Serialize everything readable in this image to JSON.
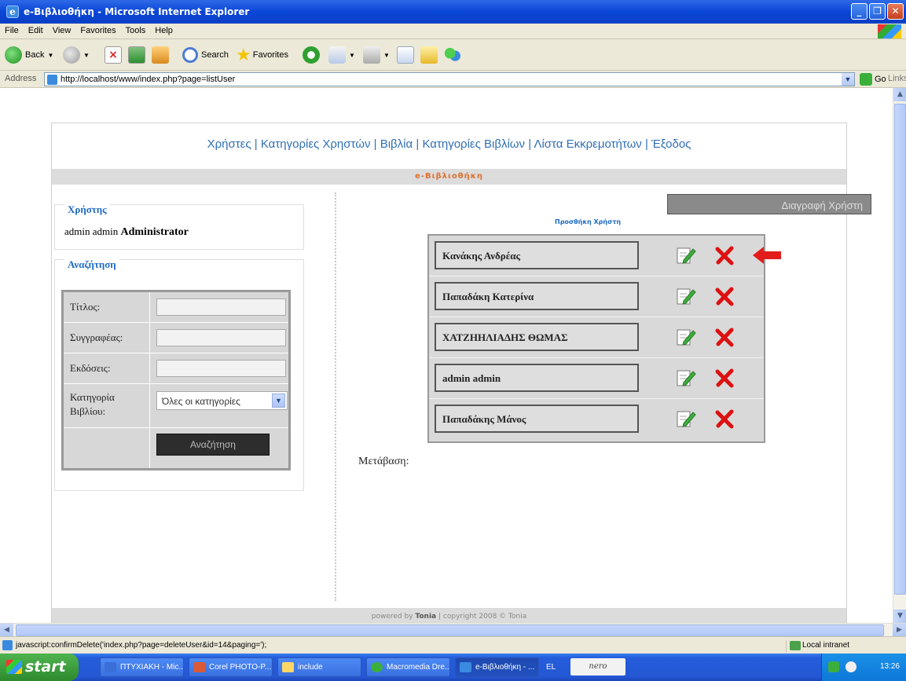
{
  "window": {
    "title": "e-Βιβλιοθήκη - Microsoft Internet Explorer",
    "ie_letter": "e"
  },
  "menu": [
    "File",
    "Edit",
    "View",
    "Favorites",
    "Tools",
    "Help"
  ],
  "toolbar": {
    "back": "Back",
    "search": "Search",
    "favorites": "Favorites"
  },
  "address": {
    "label": "Address",
    "url": "http://localhost/www/index.php?page=listUser",
    "go": "Go",
    "links": "Links"
  },
  "page": {
    "nav": [
      "Χρήστες",
      "Κατηγορίες Χρηστών",
      "Βιβλία",
      "Κατηγορίες Βιβλίων",
      "Λίστα Εκκρεμοτήτων",
      "Έξοδος"
    ],
    "nav_sep": "|",
    "brand": "e-Βιβλιοθήκη",
    "user_box": {
      "title": "Χρήστης",
      "first": "admin",
      "last": "admin",
      "role": "Administrator"
    },
    "search_box": {
      "title": "Αναζήτηση",
      "fields": [
        "Τίτλος:",
        "Συγγραφέας:",
        "Εκδόσεις:"
      ],
      "category_label": "Κατηγορία Βιβλίου:",
      "category_value": "Όλες οι κατηγορίες",
      "button": "Αναζήτηση"
    },
    "add_user_link": "Προσθήκη Χρήστη",
    "delete_banner": "Διαγραφή Χρήστη",
    "users": [
      "Κανάκης Ανδρέας",
      "Παπαδάκη Κατερίνα",
      "ΧΑΤΖΗΗΛΙΑΔΗΣ ΘΩΜΑΣ",
      "admin admin",
      "Παπαδάκης Μάνος"
    ],
    "goto_label": "Μετάβαση:",
    "footer": {
      "powered": "powered by",
      "author": "Tonia",
      "copyright": "copyright 2008 © Tonia"
    }
  },
  "status": {
    "text": "javascript:confirmDelete('index.php?page=deleteUser&id=14&paging=');",
    "zone": "Local intranet"
  },
  "taskbar": {
    "start": "start",
    "tasks": [
      "ΠΤΥΧΙΑΚΗ - Mic...",
      "Corel PHOTO-P...",
      "include",
      "Macromedia Dre...",
      "e-Βιβλιοθήκη - ..."
    ],
    "lang": "EL",
    "nero": "nero",
    "clock": "13:26"
  },
  "colors": {
    "nav_link": "#2f6fb5",
    "brand_orange": "#e07030",
    "delete_red": "#dd1111",
    "xp_blue": "#0a46d8"
  }
}
